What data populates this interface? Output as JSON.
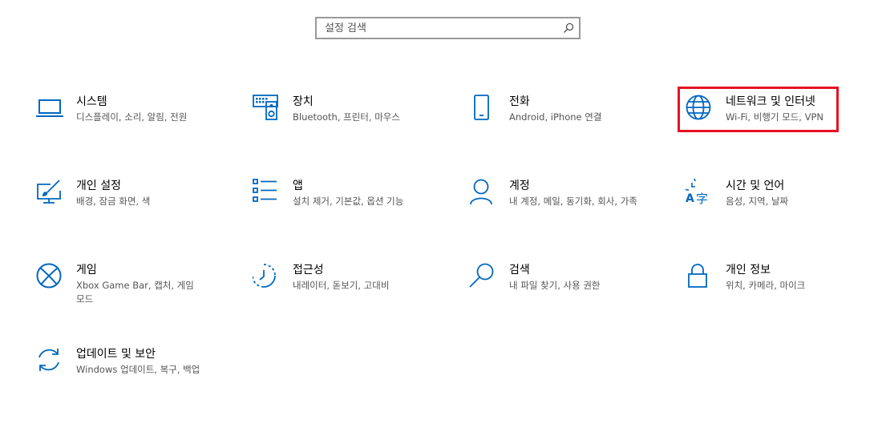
{
  "search": {
    "placeholder": "설정 검색",
    "icon": "search-icon"
  },
  "accent_color": "#0067c0",
  "highlight_color": "#e81123",
  "tiles": [
    {
      "title": "시스템",
      "desc": "디스플레이, 소리, 알림, 전원",
      "icon": "laptop-icon"
    },
    {
      "title": "장치",
      "desc": "Bluetooth, 프린터, 마우스",
      "icon": "keyboard-speaker-icon"
    },
    {
      "title": "전화",
      "desc": "Android, iPhone 연결",
      "icon": "phone-icon"
    },
    {
      "title": "네트워크 및 인터넷",
      "desc": "Wi-Fi, 비행기 모드, VPN",
      "icon": "globe-icon"
    },
    {
      "title": "개인 설정",
      "desc": "배경, 잠금 화면, 색",
      "icon": "paint-display-icon"
    },
    {
      "title": "앱",
      "desc": "설치 제거, 기본값, 옵션 기능",
      "icon": "app-list-icon"
    },
    {
      "title": "계정",
      "desc": "내 계정, 메일, 동기화, 회사, 가족",
      "icon": "person-icon"
    },
    {
      "title": "시간 및 언어",
      "desc": "음성, 지역, 날짜",
      "icon": "time-language-icon"
    },
    {
      "title": "게임",
      "desc": "Xbox Game Bar, 캡처, 게임 모드",
      "icon": "xbox-icon"
    },
    {
      "title": "접근성",
      "desc": "내레이터, 돋보기, 고대비",
      "icon": "accessibility-icon"
    },
    {
      "title": "검색",
      "desc": "내 파일 찾기, 사용 권한",
      "icon": "search-icon"
    },
    {
      "title": "개인 정보",
      "desc": "위치, 카메라, 마이크",
      "icon": "lock-icon"
    },
    {
      "title": "업데이트 및 보안",
      "desc": "Windows 업데이트, 복구, 백업",
      "icon": "sync-icon"
    }
  ]
}
